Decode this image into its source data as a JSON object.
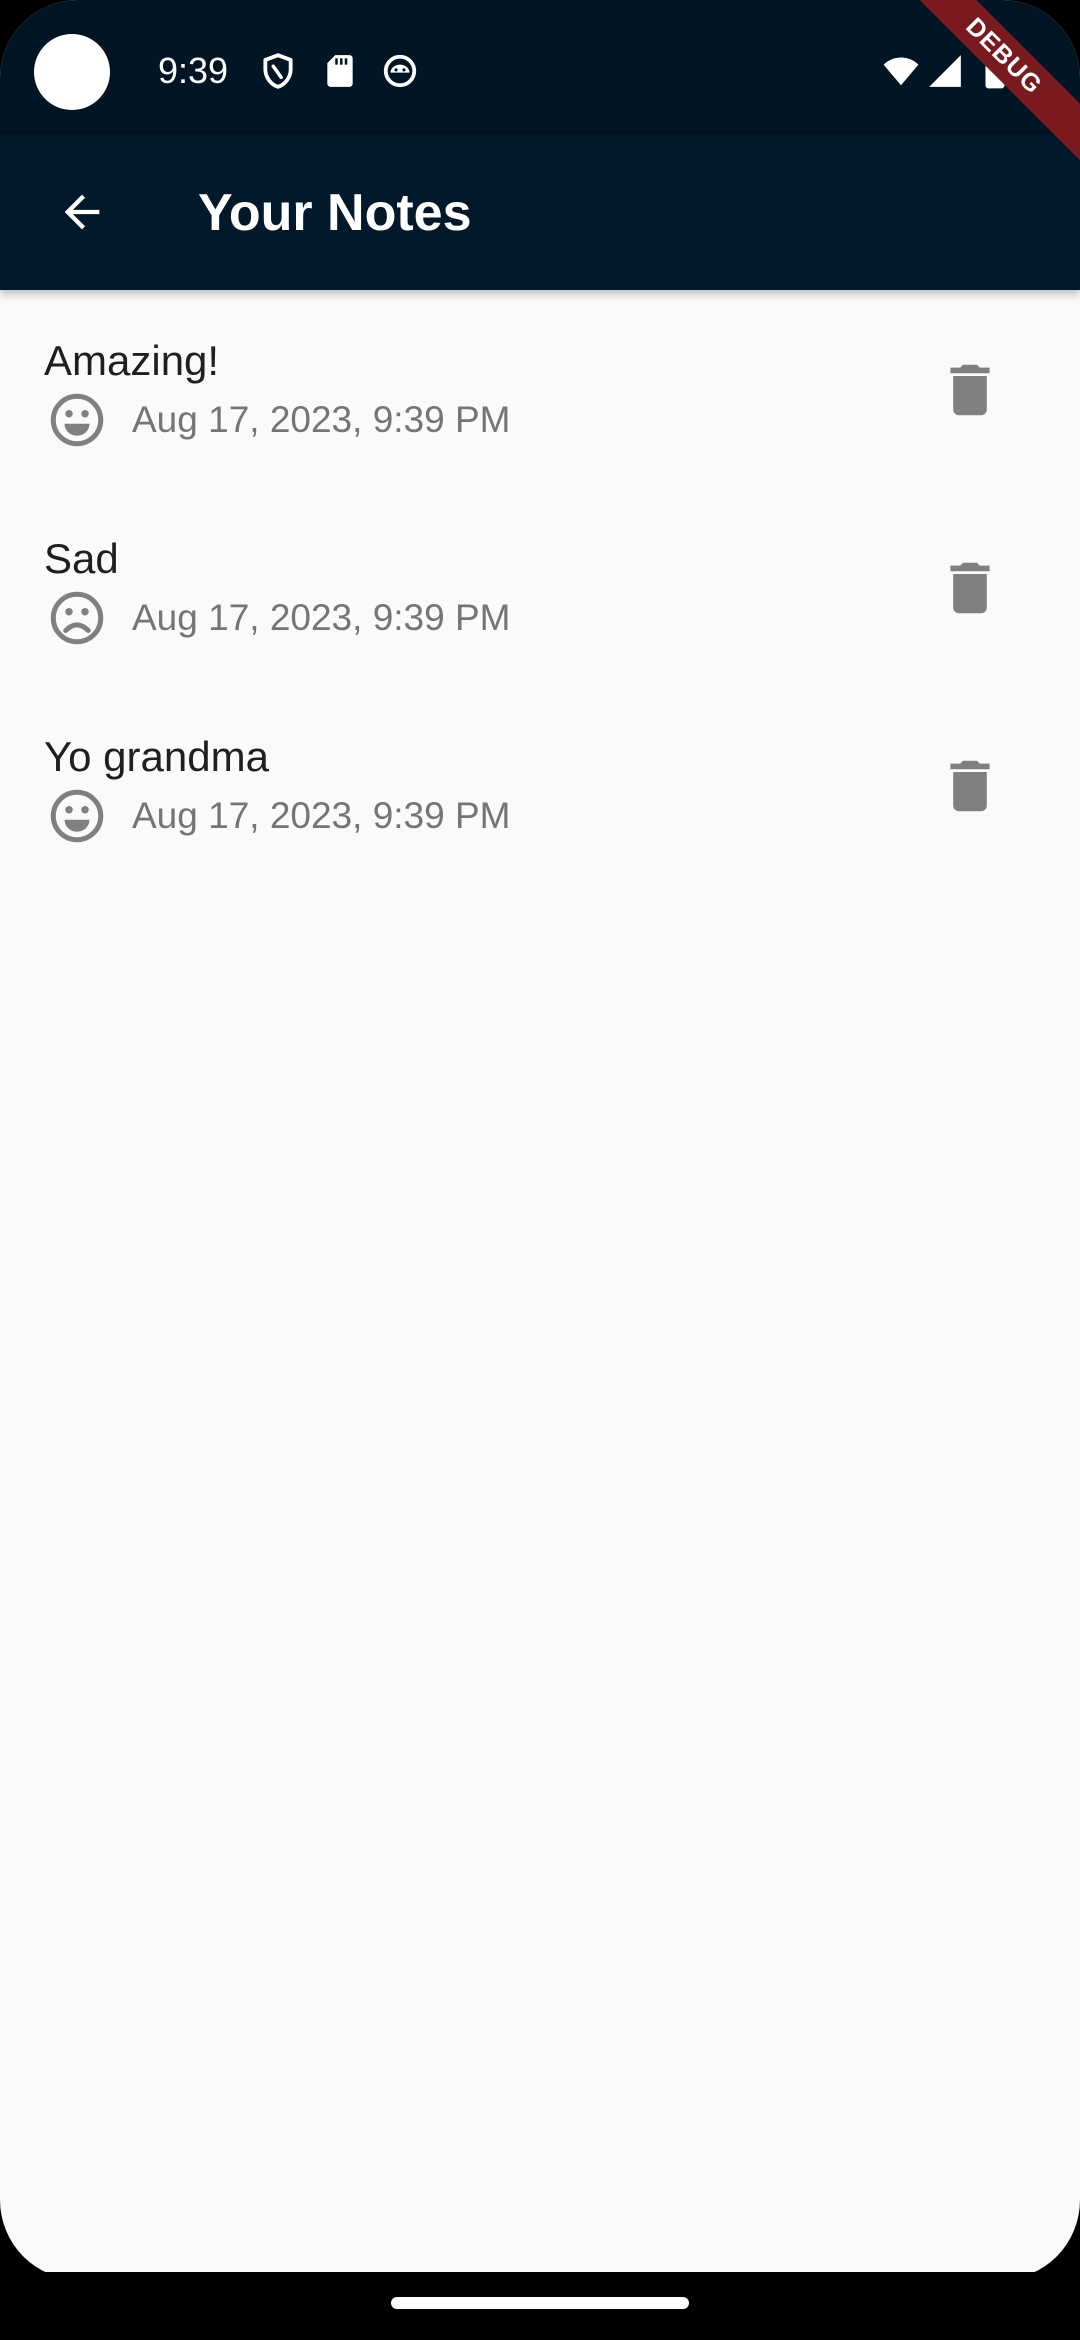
{
  "status_bar": {
    "time": "9:39",
    "left_icons": [
      "shield-icon",
      "sd-card-icon",
      "android-face-icon"
    ],
    "right_icons": [
      "wifi-icon",
      "cell-signal-icon",
      "battery-icon"
    ]
  },
  "app_bar": {
    "title": "Your Notes",
    "back_icon": "arrow-back-icon",
    "background": "#02192c"
  },
  "debug_banner": {
    "label": "DEBUG",
    "color": "#7a1a1f"
  },
  "notes": [
    {
      "title": "Amazing!",
      "mood": "happy",
      "mood_icon": "smile-icon",
      "date": "Aug 17, 2023, 9:39 PM",
      "delete_icon": "trash-icon"
    },
    {
      "title": "Sad",
      "mood": "sad",
      "mood_icon": "frown-icon",
      "date": "Aug 17, 2023, 9:39 PM",
      "delete_icon": "trash-icon"
    },
    {
      "title": "Yo grandma",
      "mood": "happy",
      "mood_icon": "smile-icon",
      "date": "Aug 17, 2023, 9:39 PM",
      "delete_icon": "trash-icon"
    }
  ],
  "colors": {
    "icon_gray": "#808080",
    "date_gray": "#757575",
    "title_text": "#1f1f1f",
    "background": "#fafafa"
  }
}
